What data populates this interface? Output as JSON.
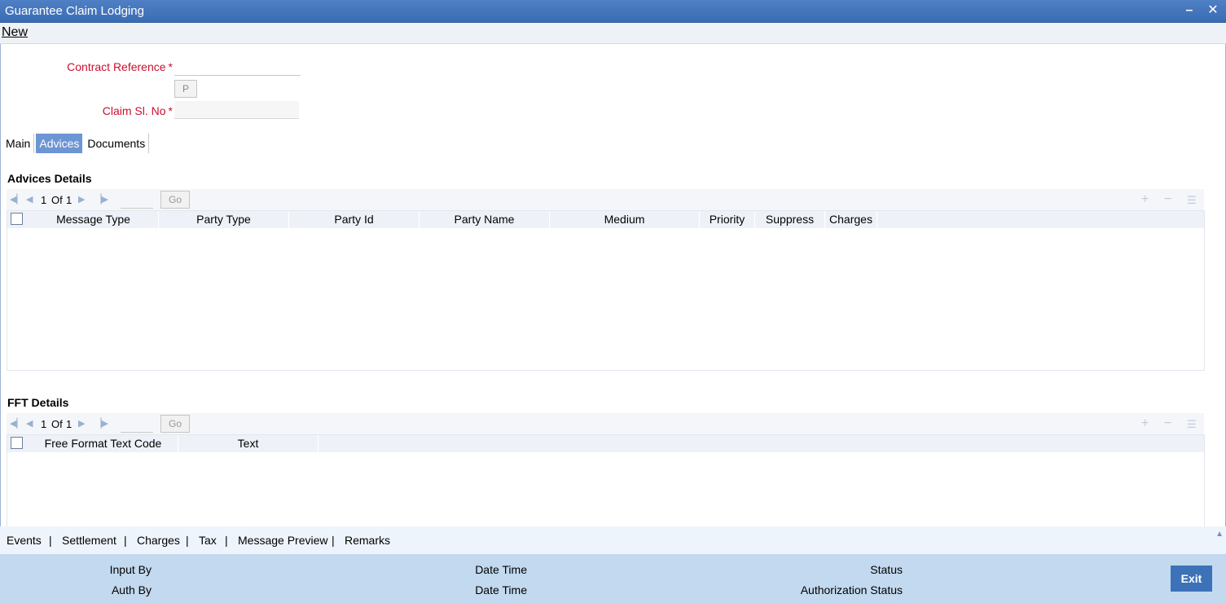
{
  "window": {
    "title": "Guarantee Claim Lodging",
    "minimize_glyph": "–",
    "close_glyph": "✕"
  },
  "menu": {
    "new_label": "New"
  },
  "form": {
    "contract_reference_label": "Contract Reference",
    "contract_reference_value": "",
    "required_mark": "*",
    "p_button_label": "P",
    "claim_sl_no_label": "Claim Sl. No",
    "claim_sl_no_value": ""
  },
  "tabs": [
    {
      "label": "Main"
    },
    {
      "label": "Advices"
    },
    {
      "label": "Documents"
    }
  ],
  "advices": {
    "title": "Advices Details",
    "pagination": {
      "current": "1",
      "of_label": "Of",
      "total": "1",
      "go_label": "Go"
    },
    "columns": [
      "Message Type",
      "Party Type",
      "Party Id",
      "Party Name",
      "Medium",
      "Priority",
      "Suppress",
      "Charges"
    ]
  },
  "fft": {
    "title": "FFT Details",
    "pagination": {
      "current": "1",
      "of_label": "Of",
      "total": "1",
      "go_label": "Go"
    },
    "columns": [
      "Free Format Text Code",
      "Text"
    ]
  },
  "bottom_links": [
    "Events",
    "Settlement",
    "Charges",
    "Tax",
    "Message Preview",
    "Remarks"
  ],
  "bottom_sep": "|",
  "footer": {
    "input_by_label": "Input By",
    "auth_by_label": "Auth By",
    "date_time_label": "Date Time",
    "status_label": "Status",
    "authorization_status_label": "Authorization Status",
    "exit_label": "Exit"
  },
  "colors": {
    "titlebar": "#3a6db5",
    "active_tab": "#6c95d4",
    "required_label": "#c8102e",
    "footer": "#c2d9ef",
    "exit_button": "#3d72b9"
  }
}
